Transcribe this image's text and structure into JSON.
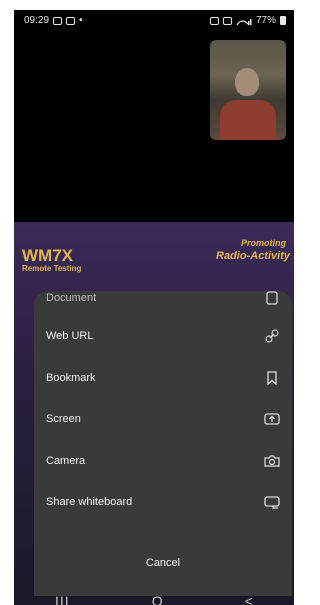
{
  "status": {
    "time": "09:29",
    "dot": "•",
    "battery": "77%"
  },
  "background_slide": {
    "brand": "WM7X",
    "brand_sub": "Remote Testing",
    "promo_line1": "Promoting",
    "promo_line2": "Radio-Activity"
  },
  "share_menu": {
    "items": [
      {
        "label": "Document",
        "icon": "document-icon"
      },
      {
        "label": "Web URL",
        "icon": "link-icon"
      },
      {
        "label": "Bookmark",
        "icon": "bookmark-icon"
      },
      {
        "label": "Screen",
        "icon": "screen-share-icon"
      },
      {
        "label": "Camera",
        "icon": "camera-icon"
      },
      {
        "label": "Share whiteboard",
        "icon": "whiteboard-icon"
      }
    ],
    "cancel_label": "Cancel"
  },
  "navbar": {
    "recent": "III",
    "home": "O",
    "back": "<"
  }
}
